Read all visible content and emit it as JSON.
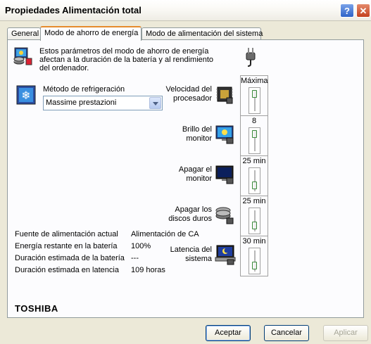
{
  "window": {
    "title": "Propiedades Alimentación total",
    "help_glyph": "?",
    "close_glyph": "✕"
  },
  "tabs": [
    {
      "label": "General",
      "active": false
    },
    {
      "label": "Modo de ahorro de energía",
      "active": true
    },
    {
      "label": "Modo de alimentación del sistema",
      "active": false
    }
  ],
  "intro": {
    "text": "Estos parámetros del modo de ahorro de energía afectan a la duración de la batería y al rendimiento del ordenador."
  },
  "cooling": {
    "label": "Método de refrigeración",
    "selected": "Massime prestazioni"
  },
  "settings": [
    {
      "label": "Velocidad del procesador",
      "value": "Máxima",
      "icon": "cpu-icon"
    },
    {
      "label": "Brillo del monitor",
      "value": "8",
      "icon": "brightness-icon"
    },
    {
      "label": "Apagar el monitor",
      "value": "25 min",
      "icon": "monitor-icon"
    },
    {
      "label": "Apagar los discos duros",
      "value": "25 min",
      "icon": "hard-disk-icon"
    },
    {
      "label": "Latencia del sistema",
      "value": "30 min",
      "icon": "standby-icon"
    }
  ],
  "status": {
    "rows": [
      {
        "label": "Fuente de alimentación actual",
        "value": "Alimentación de CA"
      },
      {
        "label": "Energía restante en la batería",
        "value": "100%"
      },
      {
        "label": "Duración estimada de la batería",
        "value": "---"
      },
      {
        "label": "Duración estimada en latencia",
        "value": "109 horas"
      }
    ]
  },
  "brand": "TOSHIBA",
  "buttons": {
    "ok": "Aceptar",
    "cancel": "Cancelar",
    "apply": "Aplicar"
  },
  "colors": {
    "accent_tab": "#e68b2c",
    "slider_thumb": "#3a8a3a",
    "button_border": "#003c74"
  }
}
